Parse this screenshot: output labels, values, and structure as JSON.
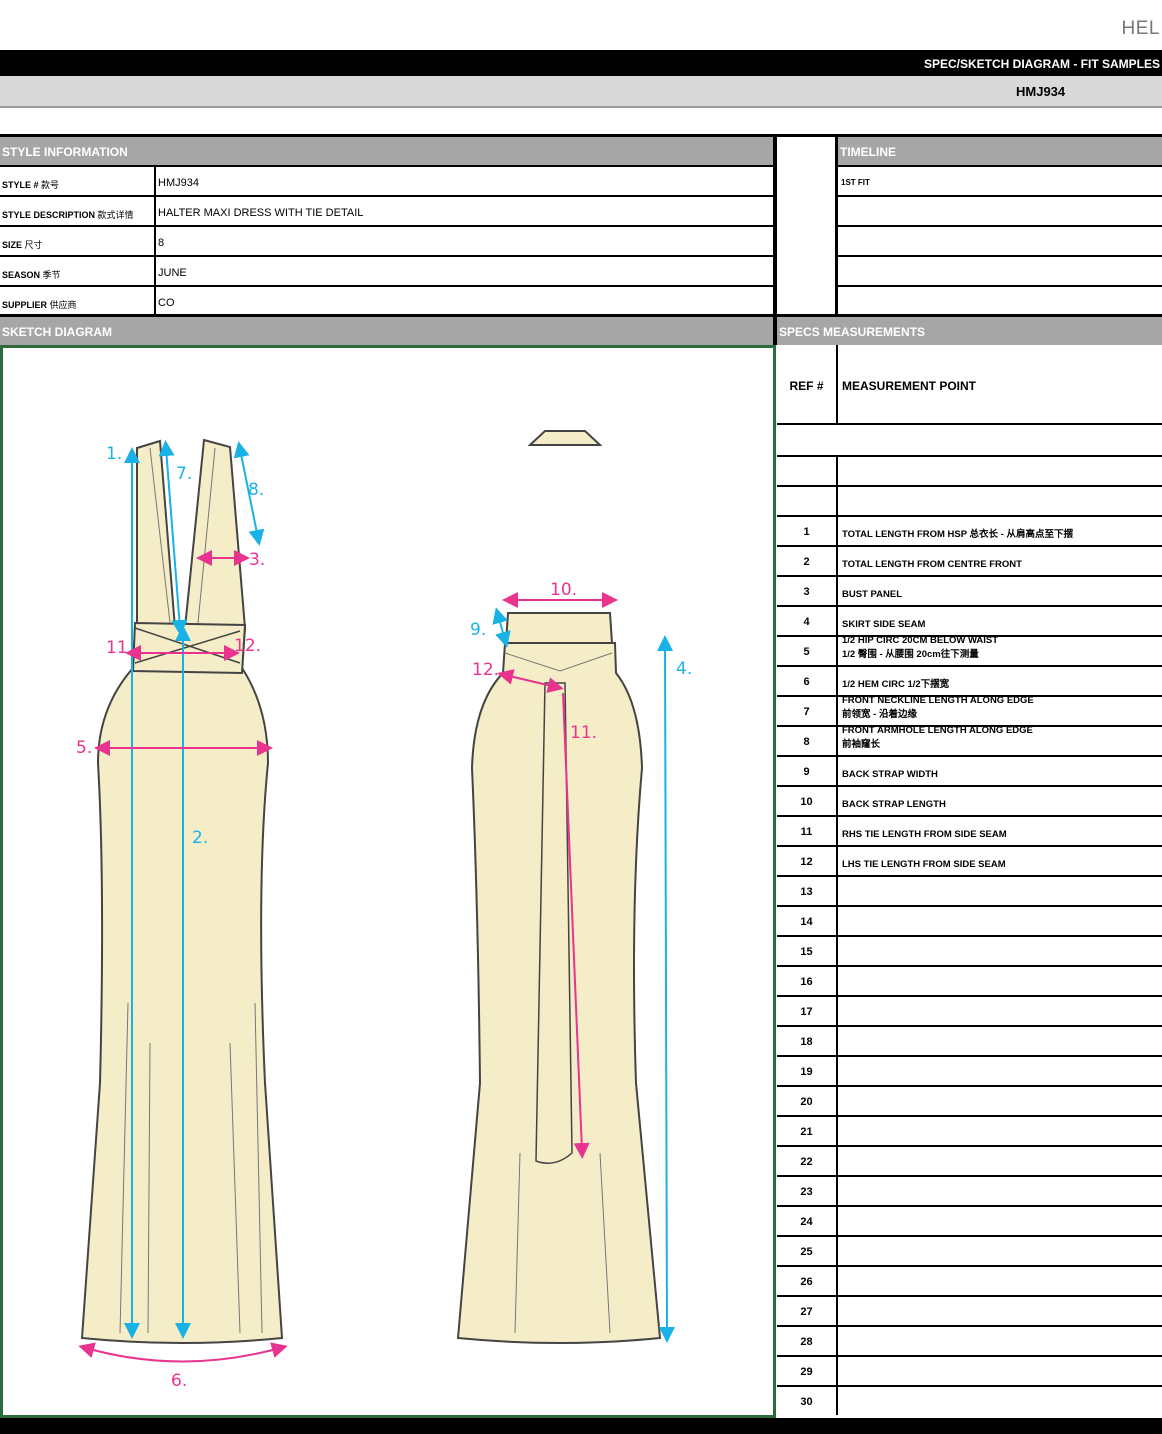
{
  "brand": "HEL",
  "header": {
    "title": "SPEC/SKETCH DIAGRAM - FIT SAMPLES",
    "style_code": "HMJ934"
  },
  "style_info": {
    "title": "STYLE INFORMATION",
    "rows": [
      {
        "label": "STYLE #",
        "label_cn": "款号",
        "value": "HMJ934"
      },
      {
        "label": "STYLE DESCRIPTION",
        "label_cn": "款式详情",
        "value": "HALTER MAXI DRESS WITH TIE DETAIL"
      },
      {
        "label": "SIZE",
        "label_cn": "尺寸",
        "value": "8"
      },
      {
        "label": "SEASON",
        "label_cn": "季节",
        "value": "JUNE"
      },
      {
        "label": "SUPPLIER",
        "label_cn": "供应商",
        "value": "CO"
      }
    ]
  },
  "timeline": {
    "title": "TIMELINE",
    "rows": [
      "1ST FIT",
      "",
      "",
      "",
      ""
    ]
  },
  "sketch": {
    "title": "SKETCH DIAGRAM",
    "front_labels": [
      "1.",
      "7.",
      "8.",
      "3.",
      "11.",
      "12.",
      "5.",
      "2.",
      "6."
    ],
    "back_labels": [
      "10.",
      "9.",
      "12.",
      "11.",
      "4."
    ],
    "colors": {
      "fabric": "#f5edc7",
      "outline": "#444444",
      "blue": "#19b2e6",
      "pink": "#e8338f"
    }
  },
  "specs": {
    "title": "SPECS MEASUREMENTS",
    "col_ref": "REF #",
    "col_point": "MEASUREMENT POINT",
    "rows": [
      {
        "ref": "1",
        "point": "TOTAL LENGTH FROM HSP 总衣长 - 从肩高点至下摆",
        "point2": ""
      },
      {
        "ref": "2",
        "point": "TOTAL LENGTH FROM CENTRE FRONT",
        "point2": ""
      },
      {
        "ref": "3",
        "point": "BUST PANEL",
        "point2": ""
      },
      {
        "ref": "4",
        "point": "SKIRT SIDE SEAM",
        "point2": ""
      },
      {
        "ref": "5",
        "point": "1/2 HIP CIRC 20CM BELOW WAIST",
        "point2": "1/2 臀围 - 从腰围 20cm往下测量"
      },
      {
        "ref": "6",
        "point": "1/2 HEM CIRC 1/2下摆宽",
        "point2": ""
      },
      {
        "ref": "7",
        "point": "FRONT NECKLINE LENGTH ALONG EDGE",
        "point2": "前领宽 - 沿着边缘"
      },
      {
        "ref": "8",
        "point": "FRONT ARMHOLE LENGTH ALONG EDGE",
        "point2": "前袖窿长"
      },
      {
        "ref": "9",
        "point": "BACK STRAP WIDTH",
        "point2": ""
      },
      {
        "ref": "10",
        "point": "BACK STRAP LENGTH",
        "point2": ""
      },
      {
        "ref": "11",
        "point": "RHS TIE LENGTH FROM SIDE SEAM",
        "point2": ""
      },
      {
        "ref": "12",
        "point": "LHS TIE LENGTH FROM SIDE SEAM",
        "point2": ""
      },
      {
        "ref": "13",
        "point": "",
        "point2": ""
      },
      {
        "ref": "14",
        "point": "",
        "point2": ""
      },
      {
        "ref": "15",
        "point": "",
        "point2": ""
      },
      {
        "ref": "16",
        "point": "",
        "point2": ""
      },
      {
        "ref": "17",
        "point": "",
        "point2": ""
      },
      {
        "ref": "18",
        "point": "",
        "point2": ""
      },
      {
        "ref": "19",
        "point": "",
        "point2": ""
      },
      {
        "ref": "20",
        "point": "",
        "point2": ""
      },
      {
        "ref": "21",
        "point": "",
        "point2": ""
      },
      {
        "ref": "22",
        "point": "",
        "point2": ""
      },
      {
        "ref": "23",
        "point": "",
        "point2": ""
      },
      {
        "ref": "24",
        "point": "",
        "point2": ""
      },
      {
        "ref": "25",
        "point": "",
        "point2": ""
      },
      {
        "ref": "26",
        "point": "",
        "point2": ""
      },
      {
        "ref": "27",
        "point": "",
        "point2": ""
      },
      {
        "ref": "28",
        "point": "",
        "point2": ""
      },
      {
        "ref": "29",
        "point": "",
        "point2": ""
      },
      {
        "ref": "30",
        "point": "",
        "point2": ""
      }
    ]
  }
}
